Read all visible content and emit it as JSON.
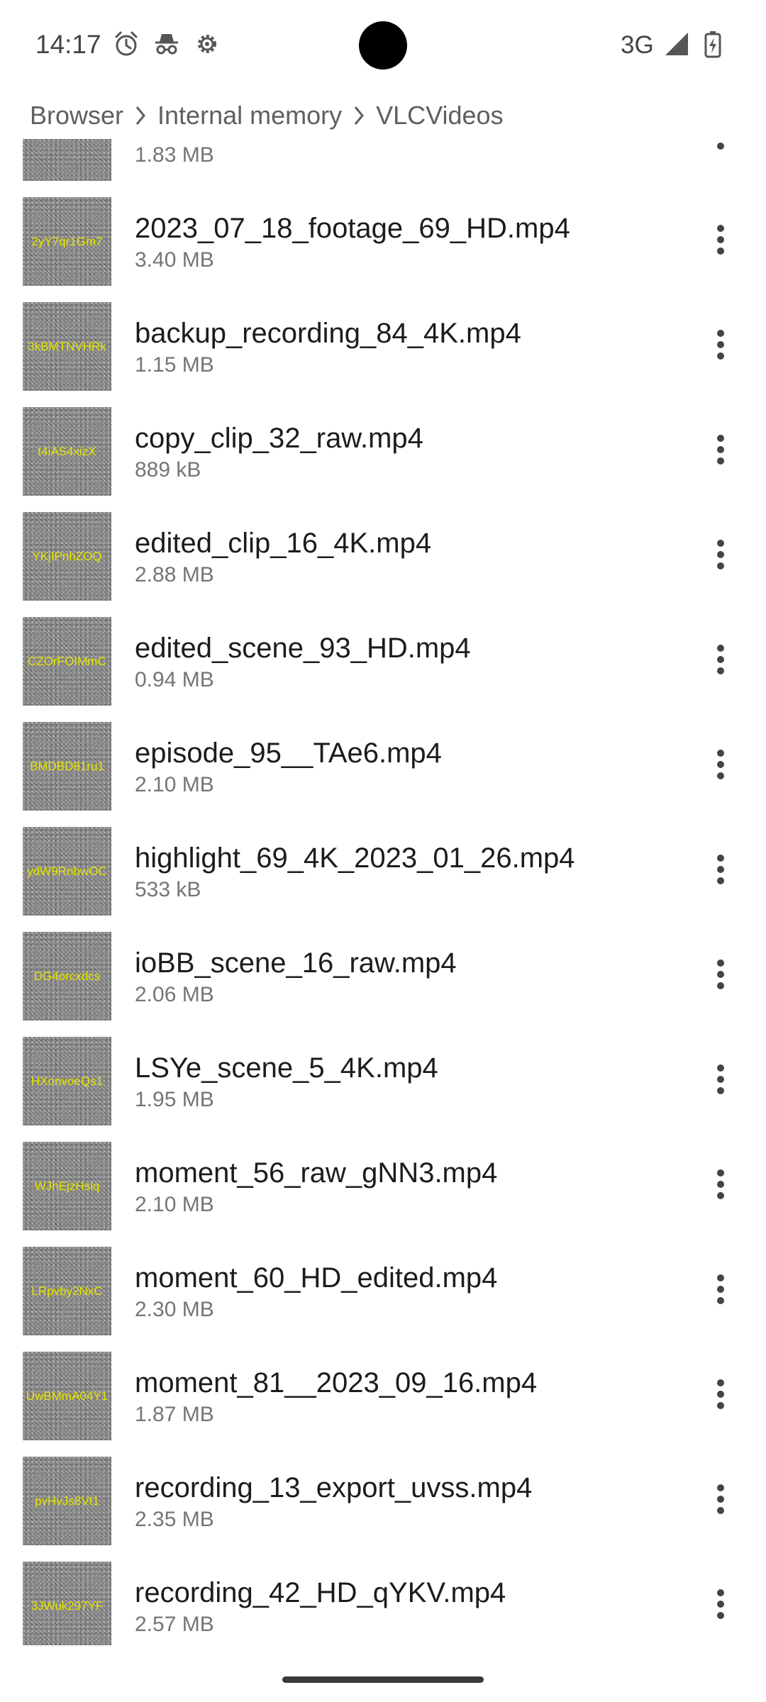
{
  "status_bar": {
    "time": "14:17",
    "network": "3G",
    "icons": [
      "alarm-icon",
      "incognito-icon",
      "settings-gear-icon",
      "signal-icon",
      "battery-charging-icon"
    ]
  },
  "breadcrumb": [
    "Browser",
    "Internal memory",
    "VLCVideos"
  ],
  "files": [
    {
      "name": "",
      "size": "1.83 MB",
      "thumb": ""
    },
    {
      "name": "2023_07_18_footage_69_HD.mp4",
      "size": "3.40 MB",
      "thumb": "2yY7qr1Gm7"
    },
    {
      "name": "backup_recording_84_4K.mp4",
      "size": "1.15 MB",
      "thumb": "3kBMTNVHRk"
    },
    {
      "name": "copy_clip_32_raw.mp4",
      "size": "889 kB",
      "thumb": "t4iAS4xizX"
    },
    {
      "name": "edited_clip_16_4K.mp4",
      "size": "2.88 MB",
      "thumb": "YKjIPnhZOQ"
    },
    {
      "name": "edited_scene_93_HD.mp4",
      "size": "0.94 MB",
      "thumb": "CZOrFOIMmC"
    },
    {
      "name": "episode_95__TAe6.mp4",
      "size": "2.10 MB",
      "thumb": "BMDBD81ru1"
    },
    {
      "name": "highlight_69_4K_2023_01_26.mp4",
      "size": "533 kB",
      "thumb": "ydW9RnbwOC"
    },
    {
      "name": "ioBB_scene_16_raw.mp4",
      "size": "2.06 MB",
      "thumb": "DG4orcxdcs"
    },
    {
      "name": "LSYe_scene_5_4K.mp4",
      "size": "1.95 MB",
      "thumb": "HXonvoeQs1"
    },
    {
      "name": "moment_56_raw_gNN3.mp4",
      "size": "2.10 MB",
      "thumb": "WJhEjzHslq"
    },
    {
      "name": "moment_60_HD_edited.mp4",
      "size": "2.30 MB",
      "thumb": "LRpvby2NxC"
    },
    {
      "name": "moment_81__2023_09_16.mp4",
      "size": "1.87 MB",
      "thumb": "UwBMmA04Y1"
    },
    {
      "name": "recording_13_export_uvss.mp4",
      "size": "2.35 MB",
      "thumb": "pvHvJs8Vt1"
    },
    {
      "name": "recording_42_HD_qYKV.mp4",
      "size": "2.57 MB",
      "thumb": "3JWuk297YF"
    }
  ]
}
